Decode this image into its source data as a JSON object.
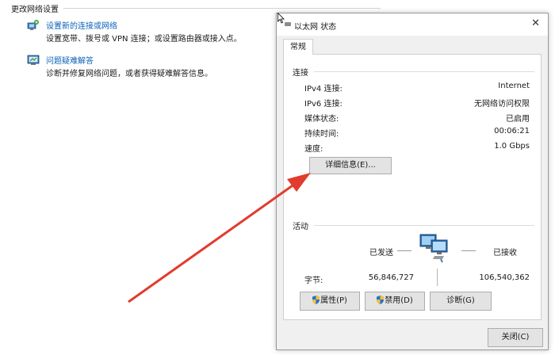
{
  "background": {
    "section_title": "更改网络设置",
    "tasks": [
      {
        "link": "设置新的连接或网络",
        "desc": "设置宽带、拨号或 VPN 连接；或设置路由器或接入点。",
        "icon": "network-setup-icon"
      },
      {
        "link": "问题疑难解答",
        "desc": "诊断并修复网络问题，或者获得疑难解答信息。",
        "icon": "troubleshoot-icon"
      }
    ]
  },
  "dialog": {
    "title": "以太网 状态",
    "close_symbol": "✕",
    "tab": "常规",
    "connection": {
      "label": "连接",
      "rows": [
        {
          "label": "IPv4 连接:",
          "value": "Internet"
        },
        {
          "label": "IPv6 连接:",
          "value": "无网络访问权限"
        },
        {
          "label": "媒体状态:",
          "value": "已启用"
        },
        {
          "label": "持续时间:",
          "value": "00:06:21"
        },
        {
          "label": "速度:",
          "value": "1.0 Gbps"
        }
      ],
      "details_button": "详细信息(E)..."
    },
    "activity": {
      "label": "活动",
      "sent_label": "已发送",
      "received_label": "已接收",
      "bytes_label": "字节:",
      "bytes_sent": "56,846,727",
      "bytes_received": "106,540,362"
    },
    "buttons": {
      "properties": "属性(P)",
      "disable": "禁用(D)",
      "diagnose": "诊断(G)",
      "close": "关闭(C)"
    }
  },
  "colors": {
    "link": "#0b62b8",
    "arrow": "#e23c2e",
    "dialog_bg": "#f0f0f0",
    "button_bg": "#e3e3e3"
  }
}
